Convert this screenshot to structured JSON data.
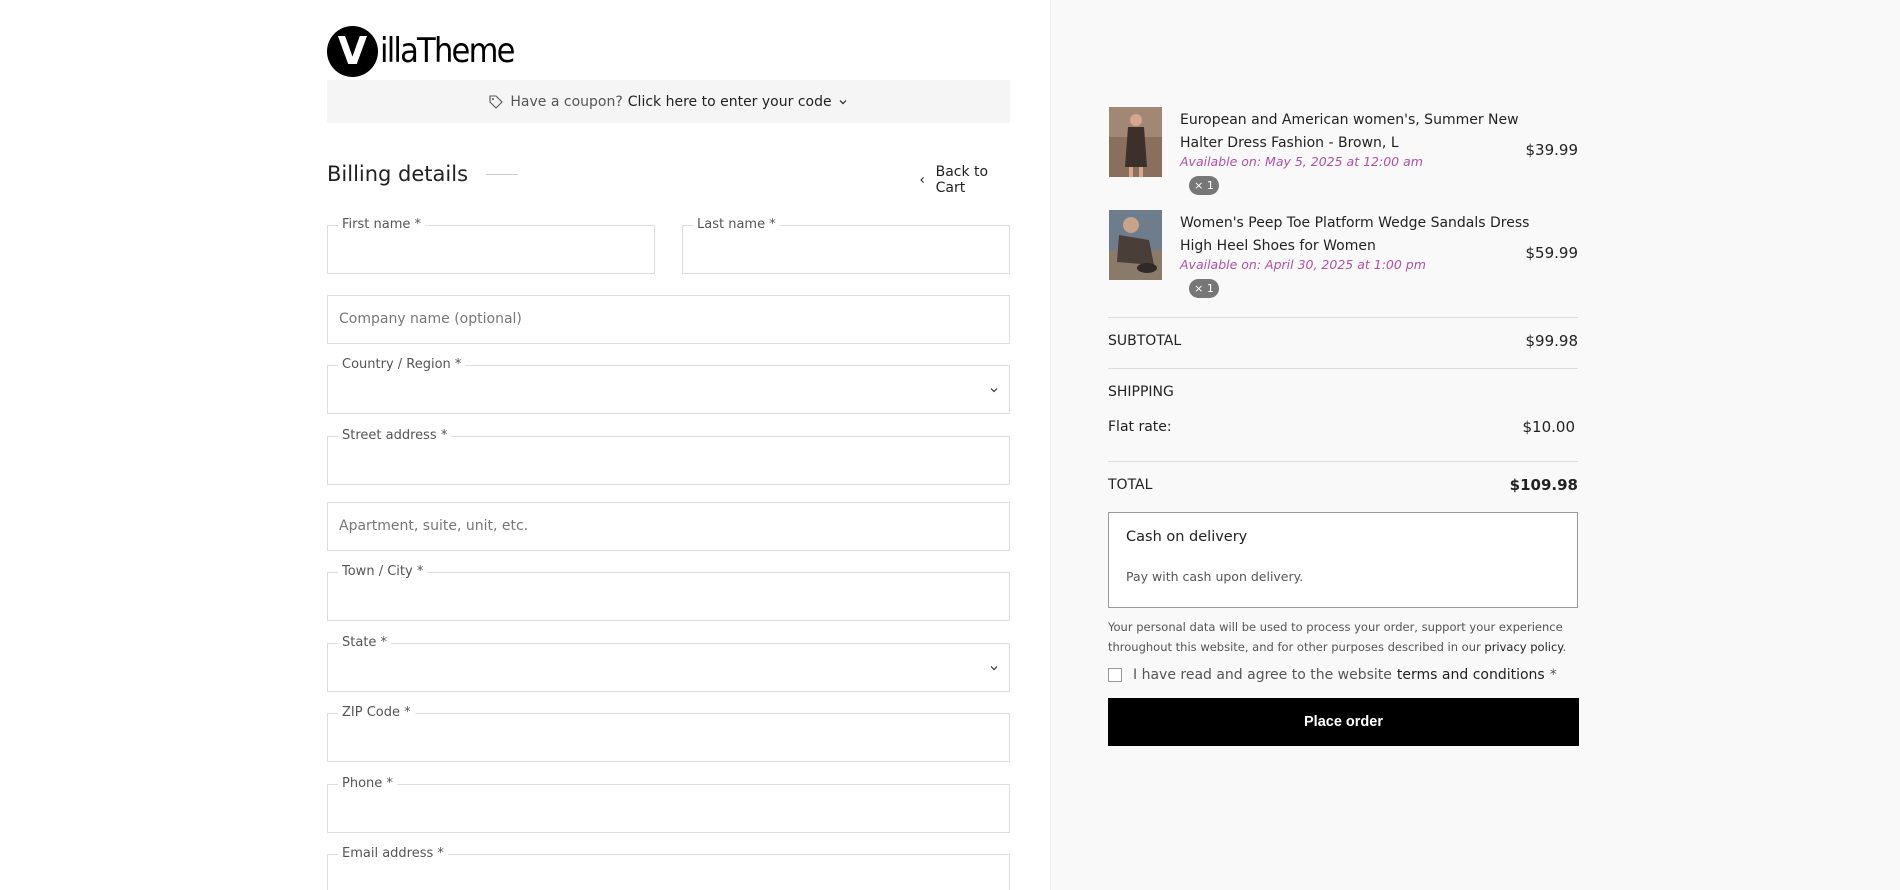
{
  "header": {
    "logo_letter": "V",
    "logo_text": "illaTheme"
  },
  "coupon": {
    "prompt": "Have a coupon?",
    "link": "Click here to enter your code"
  },
  "billing": {
    "title": "Billing details",
    "back_to_cart": "Back to Cart",
    "fields": {
      "first_name": "First name *",
      "last_name": "Last name *",
      "company": "Company name (optional)",
      "country": "Country / Region *",
      "street": "Street address *",
      "apartment": "Apartment, suite, unit, etc.",
      "city": "Town / City *",
      "state": "State *",
      "zip": "ZIP Code *",
      "phone": "Phone *",
      "email": "Email address *"
    }
  },
  "order": {
    "items": [
      {
        "name": "European and American women's, Summer New Halter Dress Fashion - Brown, L",
        "availability": "Available on: May 5, 2025 at 12:00 am",
        "qty": "× 1",
        "price": "$39.99"
      },
      {
        "name": "Women's Peep Toe Platform Wedge Sandals Dress High Heel Shoes for Women",
        "availability": "Available on: April 30, 2025 at 1:00 pm",
        "qty": "× 1",
        "price": "$59.99"
      }
    ],
    "subtotal_label": "SUBTOTAL",
    "subtotal_value": "$99.98",
    "shipping_label": "SHIPPING",
    "flat_rate_label": "Flat rate:",
    "flat_rate_value": "$10.00",
    "total_label": "TOTAL",
    "total_value": "$109.98"
  },
  "payment": {
    "title": "Cash on delivery",
    "description": "Pay with cash upon delivery."
  },
  "privacy": {
    "text": "Your personal data will be used to process your order, support your experience throughout this website, and for other purposes described in our",
    "link": "privacy policy",
    "end": "."
  },
  "terms": {
    "text": "I have read and agree to the website",
    "link": "terms and conditions",
    "required": "*"
  },
  "place_order": "Place order",
  "colors": {
    "availability": "#b04fa8",
    "button_bg": "#000000",
    "summary_bg": "#f9f9f9"
  }
}
